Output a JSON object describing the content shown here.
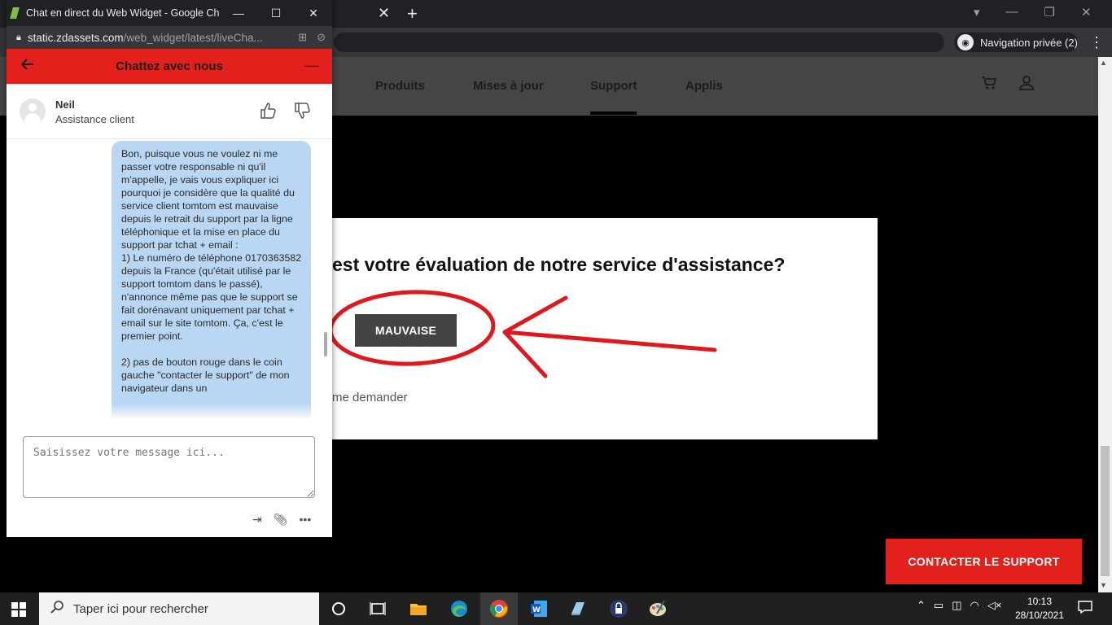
{
  "background_browser": {
    "private_label": "Navigation privée (2)",
    "nav": {
      "items": [
        "Produits",
        "Mises à jour",
        "Support",
        "Applis"
      ],
      "active": "Support"
    },
    "eval": {
      "question": "est votre évaluation de notre service d'assistance?",
      "button": "MAUVAISE",
      "later": "me demander"
    },
    "contact_button": "CONTACTER LE SUPPORT",
    "annotation_color": "#e0181e"
  },
  "popup": {
    "window_title": "Chat en direct du Web Widget - Google Ch...",
    "url_domain": "static.zdassets.com",
    "url_path": "/web_widget/latest/liveCha...",
    "chat": {
      "title": "Chattez avec nous",
      "header_color": "#e2211c",
      "agent_name": "Neil",
      "agent_role": "Assistance client",
      "message": "Bon, puisque vous ne voulez ni me passer votre responsable ni qu'il m'appelle, je vais vous expliquer ici pourquoi je considère que la qualité du service client tomtom est mauvaise depuis le retrait du support par la ligne téléphonique et la mise en place du support par tchat + email :\n1) Le numéro de téléphone 0170363582 depuis la France (qu'était utilisé par le support tomtom dans le passé), n'annonce même pas que le support se fait dorénavant uniquement par tchat + email sur le site tomtom. Ça, c'est le premier point.\n\n2) pas de bouton rouge dans le coin gauche \"contacter le support\" de mon navigateur dans un",
      "input_placeholder": "Saisissez votre message ici..."
    }
  },
  "taskbar": {
    "search_placeholder": "Taper ici pour rechercher",
    "time": "10:13",
    "date": "28/10/2021"
  }
}
